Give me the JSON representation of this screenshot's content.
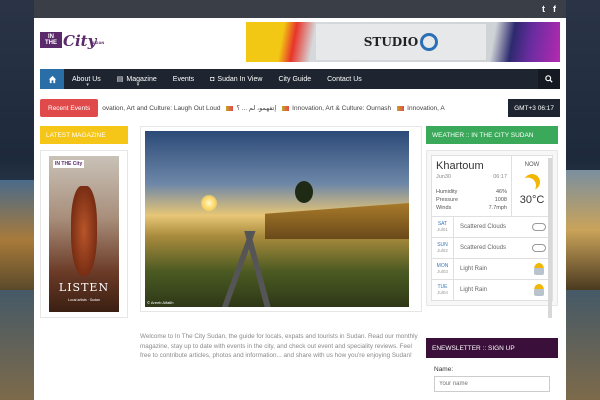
{
  "topbar": {
    "twitter": "t",
    "facebook": "f"
  },
  "logo": {
    "in": "IN",
    "the": "THE",
    "city": "City",
    "sub": "SUDAN"
  },
  "banner": {
    "studio": "STUDIO"
  },
  "nav": {
    "items": [
      {
        "label": "About Us",
        "dropdown": true
      },
      {
        "label": "Magazine",
        "dropdown": true
      },
      {
        "label": "Events",
        "dropdown": false
      },
      {
        "label": "Sudan In View",
        "dropdown": false
      },
      {
        "label": "City Guide",
        "dropdown": false
      },
      {
        "label": "Contact Us",
        "dropdown": false
      }
    ]
  },
  "ticker": {
    "label": "Recent Events",
    "items": [
      "ovation, Art and Culture: Laugh Out Loud",
      "إتفهمو، لم ... ؟",
      "Innovation, Art & Culture: Ournash",
      "Innovation, A"
    ],
    "time": "GMT+3 06:17"
  },
  "latest_magazine": {
    "heading": "LATEST MAGAZINE",
    "cover_logo": "IN THE City",
    "cover_title": "LISTEN",
    "cover_sub": "Local artists · Sudan"
  },
  "photo": {
    "credit": "© Areeb Alfatih"
  },
  "welcome": "Welcome to In The City Sudan, the guide for locals, expats and tourists in Sudan. Read our monthly magazine, stay up to date with events in the city, and check out event and speciality reviews. Feel free to contribute articles, photos and information... and share with us how you're enjoying Sudan!",
  "weather": {
    "heading": "WEATHER :: IN THE CITY SUDAN",
    "city": "Khartoum",
    "date": "Jun30",
    "time": "06:17",
    "humidity_label": "Humidity",
    "humidity": "46%",
    "pressure_label": "Pressure",
    "pressure": "1008",
    "winds_label": "Winds",
    "winds": "7.7mph",
    "now_label": "NOW",
    "temp": "30°C",
    "forecast": [
      {
        "day": "SAT",
        "date": "Jul01",
        "desc": "Scattered Clouds",
        "icon": "cloud"
      },
      {
        "day": "SUN",
        "date": "Jul02",
        "desc": "Scattered Clouds",
        "icon": "cloud"
      },
      {
        "day": "MON",
        "date": "Jul03",
        "desc": "Light Rain",
        "icon": "rain"
      },
      {
        "day": "TUE",
        "date": "Jul04",
        "desc": "Light Rain",
        "icon": "rain"
      }
    ]
  },
  "newsletter": {
    "heading": "ENEWSLETTER :: SIGN UP",
    "name_label": "Name:",
    "name_placeholder": "Your name"
  },
  "colors": {
    "accent_blue": "#2a6ea8",
    "ticker_red": "#e04a4a",
    "mag_yellow": "#f5c518",
    "weather_green": "#3aaa5a",
    "newsletter_purple": "#3a0f3a"
  }
}
